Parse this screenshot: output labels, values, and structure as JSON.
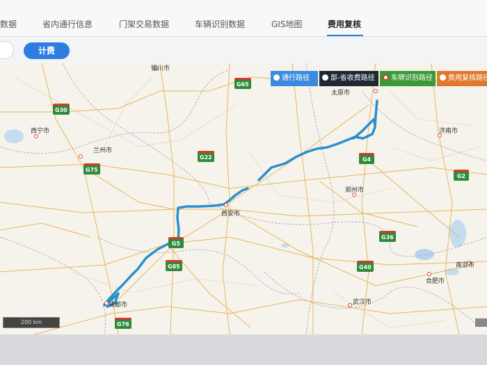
{
  "tabs": [
    {
      "label": "数据"
    },
    {
      "label": "省内通行信息"
    },
    {
      "label": "门架交易数据"
    },
    {
      "label": "车辆识别数据"
    },
    {
      "label": "GIS地图"
    },
    {
      "label": "费用复核",
      "active": true
    }
  ],
  "toolbar": {
    "calc_label": "计费"
  },
  "legend": [
    {
      "label": "通行路径",
      "color": "#3a8be0"
    },
    {
      "label": "部-省收费路径",
      "color": "#1f2833"
    },
    {
      "label": "车牌识别路径",
      "color": "#3b9a35"
    },
    {
      "label": "费用复核路径",
      "color": "#e0792f"
    }
  ],
  "cities": [
    {
      "name": "银川市"
    },
    {
      "name": "太原市"
    },
    {
      "name": "西宁市"
    },
    {
      "name": "兰州市"
    },
    {
      "name": "济南市"
    },
    {
      "name": "郑州市"
    },
    {
      "name": "西安市"
    },
    {
      "name": "合肥市"
    },
    {
      "name": "南京市"
    },
    {
      "name": "武汉市"
    },
    {
      "name": "成都市"
    }
  ],
  "highways": [
    "G65",
    "G30",
    "G22",
    "G75",
    "G4",
    "G2",
    "G5",
    "G85",
    "G36",
    "G40",
    "G76"
  ],
  "scale": {
    "label": "200 km"
  },
  "colors": {
    "route": "#2a8fcc",
    "accent": "#2f7de1"
  }
}
